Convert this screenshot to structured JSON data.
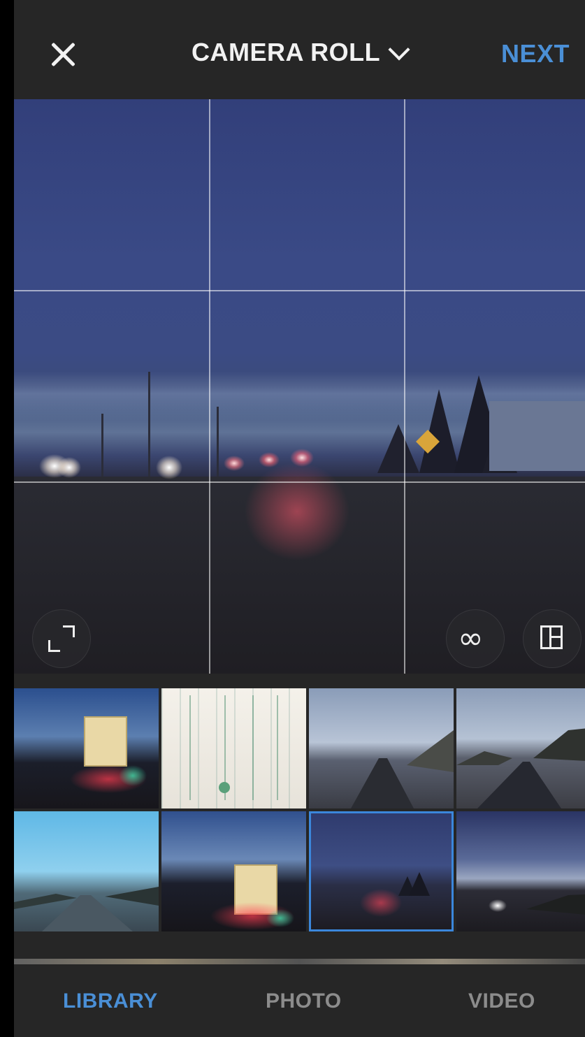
{
  "header": {
    "close_icon": "close-icon",
    "title": "CAMERA ROLL",
    "title_icon": "chevron-down-icon",
    "next_label": "NEXT",
    "accent_color": "#4a8fd6"
  },
  "preview": {
    "expand_icon": "expand-icon",
    "boomerang_icon": "infinity-icon",
    "layout_icon": "layout-icon",
    "loop_glyph": "∞",
    "grid_visible": true
  },
  "library": {
    "thumbnail_count": 8,
    "selected_index": 6
  },
  "tabs": [
    {
      "label": "LIBRARY",
      "active": true
    },
    {
      "label": "PHOTO",
      "active": false
    },
    {
      "label": "VIDEO",
      "active": false
    }
  ]
}
